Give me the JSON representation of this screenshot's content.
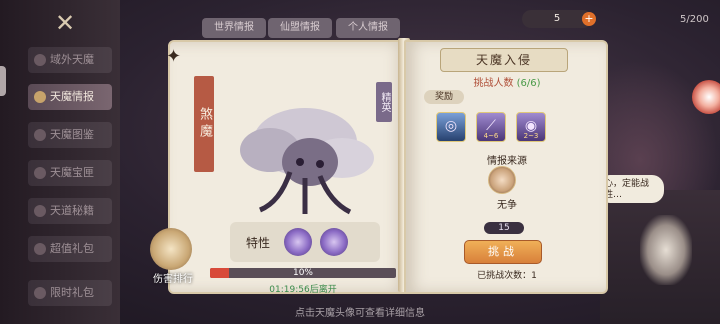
{
  "nav": {
    "items": [
      {
        "label": "域外天魔",
        "active": false
      },
      {
        "label": "天魔情报",
        "active": true
      },
      {
        "label": "天魔图鉴",
        "active": false
      },
      {
        "label": "天魔宝匣",
        "active": false
      },
      {
        "label": "天道秘籍",
        "active": false
      },
      {
        "label": "超值礼包",
        "active": false
      },
      {
        "label": "限时礼包",
        "active": false
      }
    ]
  },
  "tabs": [
    "世界情报",
    "仙盟情报",
    "个人情报"
  ],
  "currency": {
    "value": "5"
  },
  "energy": "5/200",
  "monster": {
    "name": "煞魔",
    "rank": "精英",
    "trait_label": "特性",
    "hp_percent": 10,
    "hp_text": "10%",
    "leave_timer": "01:19:56后离开"
  },
  "damage_rank_label": "伤害排行",
  "invasion": {
    "title": "天魔入侵",
    "challengers_label": "挑战人数",
    "challengers_count": "(6/6)",
    "reward_label": "奖励",
    "rewards": [
      {
        "icon": "ring-icon",
        "count": ""
      },
      {
        "icon": "staff-icon",
        "count": "4~6"
      },
      {
        "icon": "purple-orb-icon",
        "count": "2~3"
      }
    ],
    "source_label": "情报来源",
    "source_name": "无争",
    "cost": "15",
    "challenge_button": "挑战",
    "challenged_text": "已挑战次数：1"
  },
  "bubble_text": "心，定能战胜…",
  "bottom_hint": "点击天魔头像可查看详细信息",
  "colors": {
    "accent": "#d8803a",
    "banner": "#b65a44",
    "hp": "#d84a3a",
    "count_green": "#4a9a48"
  }
}
